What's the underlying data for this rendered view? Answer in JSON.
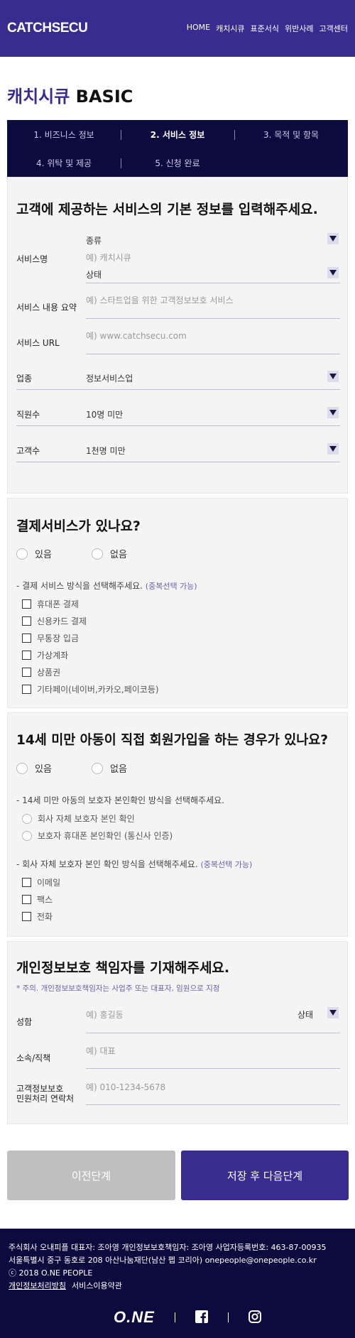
{
  "header": {
    "logo": "CATCHSECU",
    "nav": [
      "HOME",
      "캐치시큐",
      "표준서식",
      "위반사례",
      "고객센터"
    ]
  },
  "title": {
    "accent": "캐치시큐",
    "rest": " BASIC"
  },
  "steps": [
    {
      "label": "1. 비즈니스 정보"
    },
    {
      "label": "2. 서비스 정보"
    },
    {
      "label": "3. 목적 및 항목"
    },
    {
      "label": "4. 위탁 및 제공"
    },
    {
      "label": "5. 신청 완료"
    }
  ],
  "service": {
    "heading": "고객에 제공하는 서비스의 기본 정보를 입력해주세요.",
    "name_label": "서비스명",
    "type_value": "종류",
    "name_placeholder": "예) 캐치시큐",
    "status_value": "상태",
    "summary_label": "서비스 내용 요약",
    "summary_placeholder": "예) 스타트업을 위한 고객정보보호 서비스",
    "url_label": "서비스 URL",
    "url_placeholder": "예) www.catchsecu.com",
    "industry_label": "업종",
    "industry_value": "정보서비스업",
    "employees_label": "직원수",
    "employees_value": "10명 미만",
    "customers_label": "고객수",
    "customers_value": "1천명 미만"
  },
  "payment": {
    "heading": "결제서비스가 있나요?",
    "yes": "있음",
    "no": "없음",
    "prompt": "- 결제 서비스 방식을 선택해주세요.",
    "hint": "(중복선택 가능)",
    "options": [
      "휴대폰 결제",
      "신용카드 결제",
      "무통장 입금",
      "가상계좌",
      "상품권",
      "기타페이(네이버,카카오,페이코등)"
    ]
  },
  "child": {
    "heading": "14세 미만 아동이 직접 회원가입을 하는 경우가 있나요?",
    "yes": "있음",
    "no": "없음",
    "prompt1": "- 14세 미만 아동의 보호자 본인확인 방식을 선택해주세요.",
    "methods": [
      "회사 자체 보호자 본인 확인",
      "보호자 휴대폰 본인확인 (통신사 인증)"
    ],
    "prompt2": "- 회사 자체 보호자 본인 확인 방식을 선택해주세요.",
    "hint": "(중복선택 가능)",
    "options": [
      "이메일",
      "팩스",
      "전화"
    ]
  },
  "officer": {
    "heading": "개인정보보호 책임자를 기재해주세요.",
    "note": "* 주의. 개인정보보호책임자는 사업주 또는 대표자, 임원으로 지정",
    "name_label": "성함",
    "name_placeholder": "예) 홍길동",
    "status_value": "상태",
    "dept_label": "소속/직책",
    "dept_placeholder": "예) 대표",
    "contact_label_1": "고객정보보호",
    "contact_label_2": "민원처리 연락처",
    "contact_placeholder": "예) 010-1234-5678"
  },
  "buttons": {
    "prev": "이전단계",
    "next": "저장 후 다음단계"
  },
  "footer": {
    "line1": "주식회사 오내피플  대표자: 조아영  개인정보보호책임자: 조아영  사업자등록번호: 463-87-00935",
    "line2": "서울특별시 중구 동호로 208 아산나눔재단(남산 펩 코리아)  onepeople@onepeople.co.kr",
    "line3": "ⓒ 2018 O.NE PEOPLE",
    "privacy": "개인정보처리방침",
    "terms": "서비스이용약관",
    "brand": "O.NE"
  },
  "colors": {
    "primary": "#392c91",
    "dark": "#0d0b3e"
  }
}
